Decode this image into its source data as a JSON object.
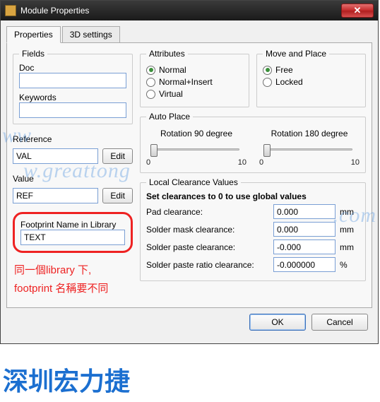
{
  "window": {
    "title": "Module Properties"
  },
  "tabs": {
    "properties": "Properties",
    "settings3d": "3D settings"
  },
  "fields": {
    "legend": "Fields",
    "doc_label": "Doc",
    "doc_value": "",
    "keywords_label": "Keywords",
    "keywords_value": "",
    "reference_label": "Reference",
    "reference_value": "VAL",
    "value_label": "Value",
    "value_value": "REF",
    "edit_label": "Edit"
  },
  "attributes": {
    "legend": "Attributes",
    "normal": "Normal",
    "normal_insert": "Normal+Insert",
    "virtual": "Virtual"
  },
  "move_place": {
    "legend": "Move and Place",
    "free": "Free",
    "locked": "Locked"
  },
  "auto_place": {
    "legend": "Auto Place",
    "rot90": "Rotation 90 degree",
    "rot180": "Rotation 180 degree",
    "min": "0",
    "max": "10"
  },
  "clearance": {
    "legend": "Local Clearance Values",
    "hint": "Set clearances to 0 to use global values",
    "pad_label": "Pad clearance:",
    "pad_value": "0.000",
    "mask_label": "Solder mask clearance:",
    "mask_value": "0.000",
    "paste_label": "Solder paste clearance:",
    "paste_value": "-0.000",
    "ratio_label": "Solder paste ratio clearance:",
    "ratio_value": "-0.000000",
    "unit_mm": "mm",
    "unit_pct": "%"
  },
  "footprint": {
    "label": "Footprint Name in Library",
    "value": "TEXT"
  },
  "note": {
    "line1": "同一個library 下,",
    "line2": "footprint 名稱要不同"
  },
  "footer": {
    "ok": "OK",
    "cancel": "Cancel"
  },
  "watermark": {
    "w1a": "ww",
    "w1b": "w.greattong",
    "w1c": ".com",
    "brand": "深圳宏力捷"
  }
}
